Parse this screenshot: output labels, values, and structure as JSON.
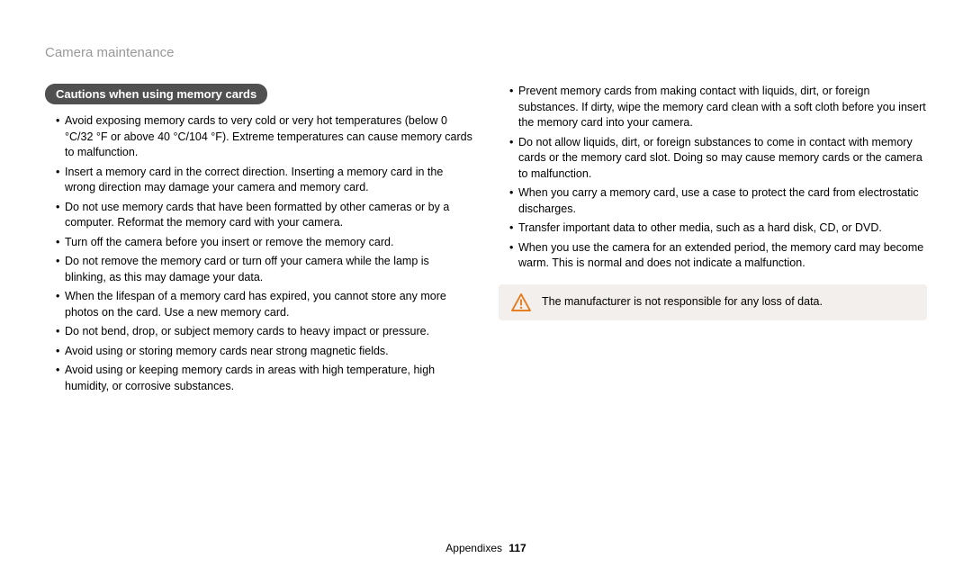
{
  "header": {
    "title": "Camera maintenance"
  },
  "section": {
    "heading": "Cautions when using memory cards"
  },
  "left_bullets": [
    "Avoid exposing memory cards to very cold or very hot temperatures (below 0 °C/32 °F or above 40 °C/104 °F). Extreme temperatures can cause memory cards to malfunction.",
    "Insert a memory card in the correct direction. Inserting a memory card in the wrong direction may damage your camera and memory card.",
    "Do not use memory cards that have been formatted by other cameras or by a computer. Reformat the memory card with your camera.",
    "Turn off the camera before you insert or remove the memory card.",
    "Do not remove the memory card or turn off your camera while the lamp is blinking, as this may damage your data.",
    "When the lifespan of a memory card has expired, you cannot store any more photos on the card. Use a new memory card.",
    "Do not bend, drop, or subject memory cards to heavy impact or pressure.",
    "Avoid using or storing memory cards near strong magnetic fields.",
    "Avoid using or keeping memory cards in areas with high temperature, high humidity, or corrosive substances."
  ],
  "right_bullets": [
    "Prevent memory cards from making contact with liquids, dirt, or foreign substances. If dirty, wipe the memory card clean with a soft cloth before you insert the memory card into your camera.",
    "Do not allow liquids, dirt, or foreign substances to come in contact with memory cards or the memory card slot. Doing so may cause memory cards or the camera to malfunction.",
    "When you carry a memory card, use a case to protect the card from electrostatic discharges.",
    "Transfer important data to other media, such as a hard disk, CD, or DVD.",
    "When you use the camera for an extended period, the memory card may become warm. This is normal and does not indicate a malfunction."
  ],
  "note": {
    "text": "The manufacturer is not responsible for any loss of data."
  },
  "footer": {
    "section": "Appendixes",
    "page": "117"
  }
}
